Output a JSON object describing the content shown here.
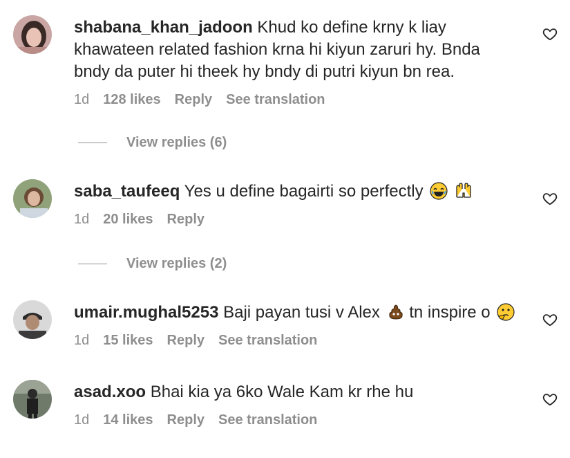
{
  "comments": [
    {
      "username": "shabana_khan_jadoon",
      "text_lines": [
        "Khud ko define krny k liay",
        "khawateen related fashion krna hi kiyun zaruri hy. Bnda",
        "bndy da puter hi theek hy bndy di putri kiyun bn rea."
      ],
      "time": "1d",
      "likes": "128 likes",
      "reply": "Reply",
      "translation": "See translation",
      "view_replies": "View replies (6)"
    },
    {
      "username": "saba_taufeeq",
      "text": "Yes u define bagairti so perfectly",
      "emojis": [
        "laughing-tears-emoji",
        "raising-hands-emoji"
      ],
      "time": "1d",
      "likes": "20 likes",
      "reply": "Reply",
      "view_replies": "View replies (2)"
    },
    {
      "username": "umair.mughal5253",
      "text_before": "Baji payan tusi v Alex",
      "text_after": "tn inspire o",
      "emojis": [
        "poop-emoji",
        "thinking-face-emoji"
      ],
      "time": "1d",
      "likes": "15 likes",
      "reply": "Reply",
      "translation": "See translation"
    },
    {
      "username": "asad.xoo",
      "text": "Bhai kia ya 6ko Wale Kam kr rhe hu",
      "time": "1d",
      "likes": "14 likes",
      "reply": "Reply",
      "translation": "See translation"
    }
  ],
  "colors": {
    "text": "#262626",
    "secondary": "#8e8e8e",
    "background": "#ffffff"
  }
}
